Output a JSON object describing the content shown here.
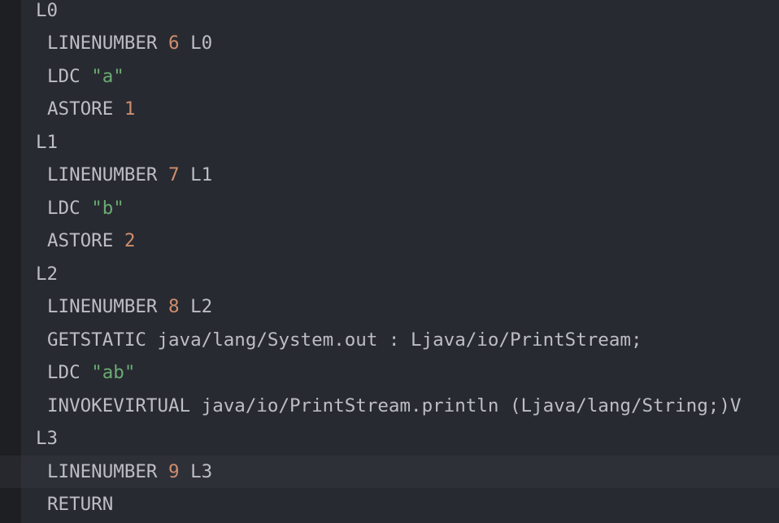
{
  "code": {
    "lines": [
      {
        "kind": "label",
        "parts": [
          {
            "t": "L0",
            "c": "plain"
          }
        ]
      },
      {
        "kind": "instr",
        "parts": [
          {
            "t": "LINENUMBER ",
            "c": "plain"
          },
          {
            "t": "6",
            "c": "num"
          },
          {
            "t": " L0",
            "c": "plain"
          }
        ]
      },
      {
        "kind": "instr",
        "parts": [
          {
            "t": "LDC ",
            "c": "plain"
          },
          {
            "t": "\"a\"",
            "c": "str"
          }
        ]
      },
      {
        "kind": "instr",
        "parts": [
          {
            "t": "ASTORE ",
            "c": "plain"
          },
          {
            "t": "1",
            "c": "num"
          }
        ]
      },
      {
        "kind": "label",
        "parts": [
          {
            "t": "L1",
            "c": "plain"
          }
        ]
      },
      {
        "kind": "instr",
        "parts": [
          {
            "t": "LINENUMBER ",
            "c": "plain"
          },
          {
            "t": "7",
            "c": "num"
          },
          {
            "t": " L1",
            "c": "plain"
          }
        ]
      },
      {
        "kind": "instr",
        "parts": [
          {
            "t": "LDC ",
            "c": "plain"
          },
          {
            "t": "\"b\"",
            "c": "str"
          }
        ]
      },
      {
        "kind": "instr",
        "parts": [
          {
            "t": "ASTORE ",
            "c": "plain"
          },
          {
            "t": "2",
            "c": "num"
          }
        ]
      },
      {
        "kind": "label",
        "parts": [
          {
            "t": "L2",
            "c": "plain"
          }
        ]
      },
      {
        "kind": "instr",
        "parts": [
          {
            "t": "LINENUMBER ",
            "c": "plain"
          },
          {
            "t": "8",
            "c": "num"
          },
          {
            "t": " L2",
            "c": "plain"
          }
        ]
      },
      {
        "kind": "instr",
        "parts": [
          {
            "t": "GETSTATIC java/lang/System.out : Ljava/io/PrintStream;",
            "c": "plain"
          }
        ]
      },
      {
        "kind": "instr",
        "parts": [
          {
            "t": "LDC ",
            "c": "plain"
          },
          {
            "t": "\"ab\"",
            "c": "str"
          }
        ]
      },
      {
        "kind": "instr",
        "parts": [
          {
            "t": "INVOKEVIRTUAL java/io/PrintStream.println (Ljava/lang/String;)V",
            "c": "plain"
          }
        ]
      },
      {
        "kind": "label",
        "parts": [
          {
            "t": "L3",
            "c": "plain"
          }
        ]
      },
      {
        "kind": "instr",
        "current": true,
        "parts": [
          {
            "t": "LINENUMBER ",
            "c": "plain"
          },
          {
            "t": "9",
            "c": "num"
          },
          {
            "t": " L3",
            "c": "plain"
          }
        ]
      },
      {
        "kind": "instr",
        "parts": [
          {
            "t": "RETURN",
            "c": "plain"
          }
        ]
      }
    ]
  },
  "colors": {
    "background": "#282a31",
    "current_line": "#2e3038",
    "text": "#bcbec4",
    "number": "#cf8e6d",
    "string": "#6aab73"
  }
}
